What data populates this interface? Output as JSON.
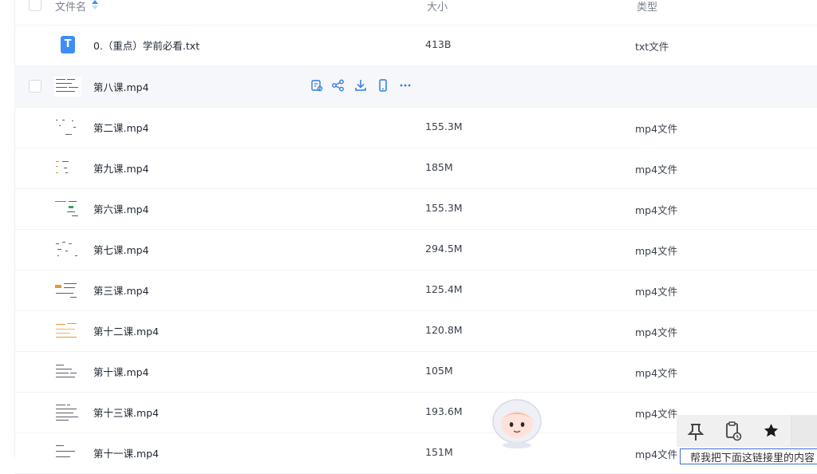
{
  "columns": {
    "name": "文件名",
    "size": "大小",
    "type": "类型"
  },
  "files": [
    {
      "name": "0.（重点）学前必看.txt",
      "size": "413B",
      "type": "txt文件",
      "icon": "txt-file-icon"
    },
    {
      "name": "第八课.mp4",
      "size": "",
      "type": "",
      "icon": "video-thumbnail"
    },
    {
      "name": "第二课.mp4",
      "size": "155.3M",
      "type": "mp4文件",
      "icon": "video-thumbnail"
    },
    {
      "name": "第九课.mp4",
      "size": "185M",
      "type": "mp4文件",
      "icon": "video-thumbnail"
    },
    {
      "name": "第六课.mp4",
      "size": "155.3M",
      "type": "mp4文件",
      "icon": "video-thumbnail"
    },
    {
      "name": "第七课.mp4",
      "size": "294.5M",
      "type": "mp4文件",
      "icon": "video-thumbnail"
    },
    {
      "name": "第三课.mp4",
      "size": "125.4M",
      "type": "mp4文件",
      "icon": "video-thumbnail"
    },
    {
      "name": "第十二课.mp4",
      "size": "120.8M",
      "type": "mp4文件",
      "icon": "video-thumbnail"
    },
    {
      "name": "第十课.mp4",
      "size": "105M",
      "type": "mp4文件",
      "icon": "video-thumbnail"
    },
    {
      "name": "第十三课.mp4",
      "size": "193.6M",
      "type": "mp4文件",
      "icon": "video-thumbnail"
    },
    {
      "name": "第十一课.mp4",
      "size": "151M",
      "type": "mp4文件",
      "icon": "video-thumbnail"
    }
  ],
  "row_actions": [
    "ai-summary-icon",
    "share-icon",
    "download-icon",
    "send-to-phone-icon",
    "more-icon"
  ],
  "floating_toolbar": {
    "buttons": [
      "pin-icon",
      "clipboard-history-icon",
      "star-icon"
    ],
    "input_text": "帮我把下面这链接里的内容"
  },
  "colors": {
    "accent": "#3f8cf7",
    "hover_row": "#f6f7fa",
    "text": "#1f2633",
    "muted": "#7a818f"
  }
}
